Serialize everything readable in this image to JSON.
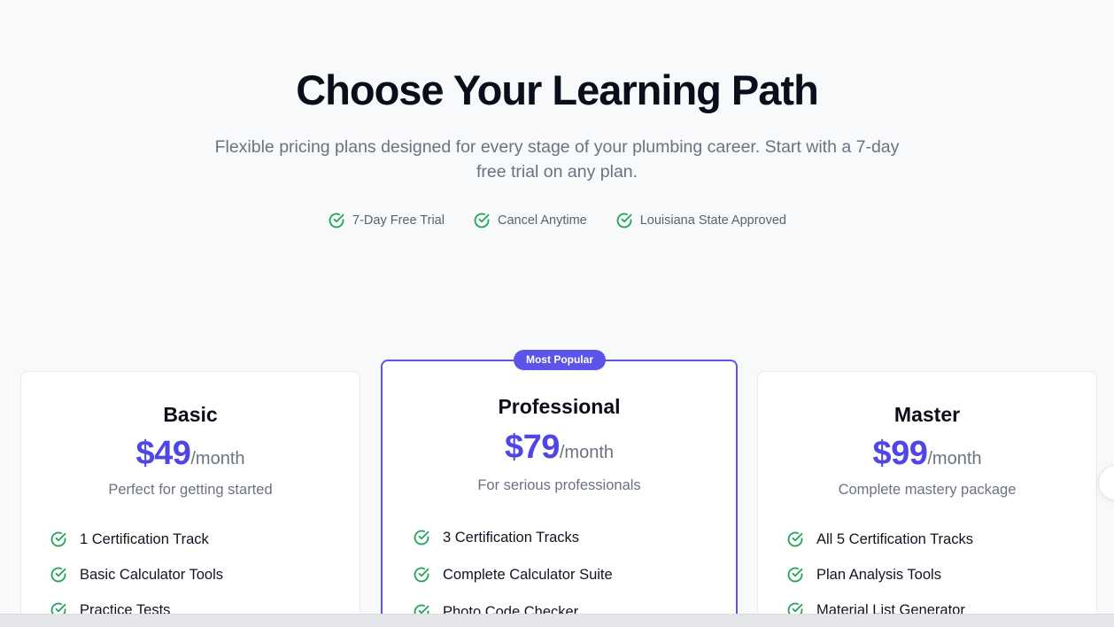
{
  "hero": {
    "title": "Choose Your Learning Path",
    "subtitle": "Flexible pricing plans designed for every stage of your plumbing career. Start with a 7-day free trial on any plan.",
    "badges": [
      "7-Day Free Trial",
      "Cancel Anytime",
      "Louisiana State Approved"
    ]
  },
  "plans": [
    {
      "name": "Basic",
      "price": "$49",
      "period": "/month",
      "description": "Perfect for getting started",
      "features": [
        "1 Certification Track",
        "Basic Calculator Tools",
        "Practice Tests"
      ]
    },
    {
      "name": "Professional",
      "badge": "Most Popular",
      "price": "$79",
      "period": "/month",
      "description": "For serious professionals",
      "features": [
        "3 Certification Tracks",
        "Complete Calculator Suite",
        "Photo Code Checker"
      ]
    },
    {
      "name": "Master",
      "price": "$99",
      "period": "/month",
      "description": "Complete mastery package",
      "features": [
        "All 5 Certification Tracks",
        "Plan Analysis Tools",
        "Material List Generator"
      ]
    }
  ],
  "colors": {
    "accent": "#4f46e5",
    "featured_border": "#5a55e6",
    "check": "#22a55a",
    "background": "#f8f9fb"
  },
  "icons": {
    "feature": "check-circle-icon"
  }
}
